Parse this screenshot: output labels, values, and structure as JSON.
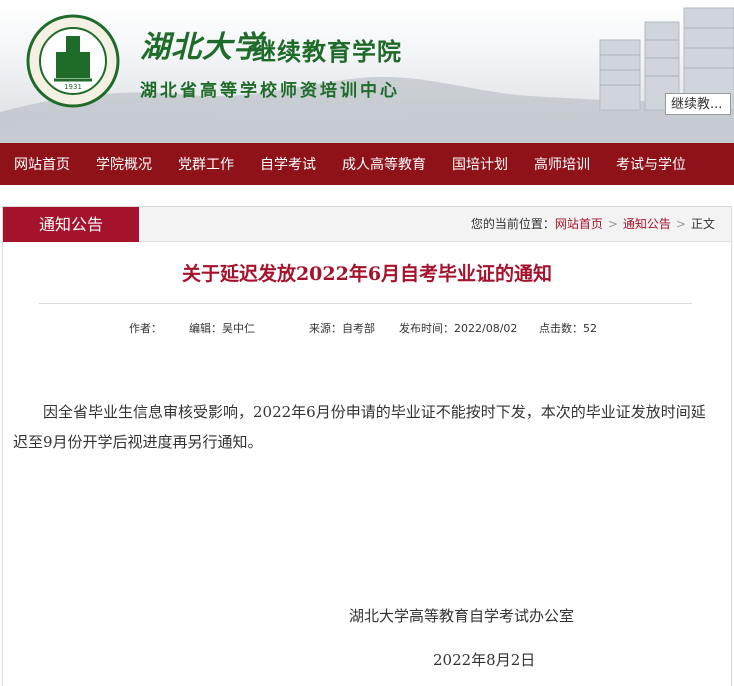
{
  "header": {
    "brand_script": "湖北大学",
    "brand_name": "继续教育学院",
    "brand_sub": "湖北省高等学校师资培训中心",
    "logo_text": "1931",
    "search_value": "继续教..."
  },
  "nav": {
    "items": [
      "网站首页",
      "学院概况",
      "党群工作",
      "自学考试",
      "成人高等教育",
      "国培计划",
      "高师培训",
      "考试与学位"
    ]
  },
  "section": {
    "tab_label": "通知公告",
    "breadcrumb": {
      "prefix": "您的当前位置：",
      "home": "网站首页",
      "category": "通知公告",
      "current": "正文"
    }
  },
  "article": {
    "title": "关于延迟发放2022年6月自考毕业证的通知",
    "meta": {
      "author": "作者：",
      "editor": "编辑：吴中仁",
      "source": "来源：自考部",
      "published": "发布时间：2022/08/02",
      "clicks": "点击数：52"
    },
    "body": "因全省毕业生信息审核受影响，2022年6月份申请的毕业证不能按时下发，本次的毕业证发放时间延迟至9月份开学后视进度再另行通知。",
    "signature": "湖北大学高等教育自学考试办公室",
    "date": "2022年8月2日"
  },
  "colors": {
    "nav_bg": "#8e1218",
    "accent": "#a5122b",
    "brand_green": "#1f6b2a"
  }
}
